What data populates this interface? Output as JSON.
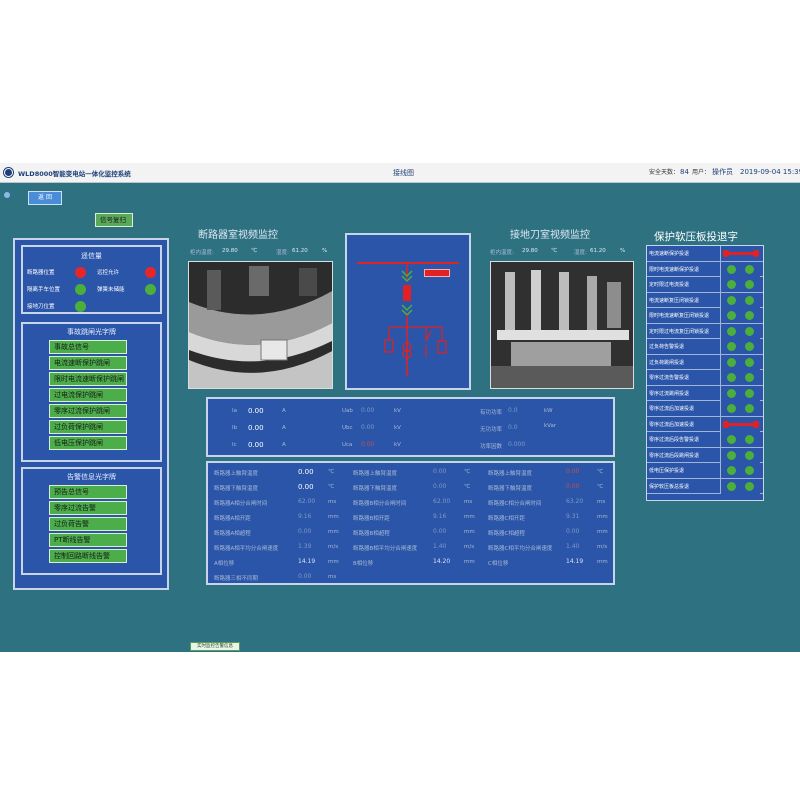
{
  "titlebar": {
    "app_title": "WLD8000智能变电站一体化监控系统",
    "page_name": "接线图",
    "safe_days_label": "安全天数：",
    "safe_days_value": "84",
    "user_label": "用户：",
    "user_value": "操作员",
    "datetime": "2019-09-04 15:39:"
  },
  "top_small_button": "返 回",
  "signal_reset": "信号复归",
  "status_panel": {
    "title": "遥信量",
    "items": [
      {
        "label": "断路器位置",
        "color": "#e8262a"
      },
      {
        "label": "远控允许",
        "color": "#e8262a"
      },
      {
        "label": "隔离手车位置",
        "color": "#4caf3c"
      },
      {
        "label": "弹簧未储能",
        "color": "#4caf3c"
      },
      {
        "label": "接地刀位置",
        "color": "#4caf3c"
      }
    ]
  },
  "trip_panel": {
    "title": "事故跳闸光字牌",
    "buttons": [
      "事故总信号",
      "电流速断保护跳闸",
      "限时电流速断保护跳闸",
      "过电流保护跳闸",
      "零序过流保护跳闸",
      "过负荷保护跳闸",
      "低电压保护跳闸"
    ]
  },
  "alarm_panel": {
    "title": "告警信息光字牌",
    "buttons": [
      "预告总信号",
      "零序过流告警",
      "过负荷告警",
      "PT断线告警",
      "控制回路断线告警"
    ]
  },
  "cam_left": {
    "title": "断路器室视频监控",
    "temp_label": "柜内温度:",
    "temp_value": "29.80",
    "temp_unit": "℃",
    "hum_label": "湿度:",
    "hum_value": "61.20",
    "hum_unit": "%"
  },
  "cam_right": {
    "title": "接地刀室视频监控",
    "temp_label": "柜内温度:",
    "temp_value": "29.80",
    "temp_unit": "℃",
    "hum_label": "湿度:",
    "hum_value": "61.20",
    "hum_unit": "%"
  },
  "diagram": {
    "tag_label": ""
  },
  "measurements": {
    "rows": [
      {
        "a_label": "Ia",
        "a_value": "0.00",
        "a_unit": "A",
        "b_label": "Uab",
        "b_value": "0.00",
        "b_unit": "kV",
        "c_label": "有功功率",
        "c_value": "0.0",
        "c_unit": "kW"
      },
      {
        "a_label": "Ib",
        "a_value": "0.00",
        "a_unit": "A",
        "b_label": "Ubc",
        "b_value": "0.00",
        "b_unit": "kV",
        "c_label": "无功功率",
        "c_value": "0.0",
        "c_unit": "kVar"
      },
      {
        "a_label": "Ic",
        "a_value": "0.00",
        "a_unit": "A",
        "b_label": "Uca",
        "b_value": "0.00",
        "b_unit": "kV",
        "c_label": "功率因数",
        "c_value": "0.000",
        "c_unit": ""
      }
    ]
  },
  "breaker": {
    "col1": [
      {
        "label": "断路器上触臂温度",
        "value": "0.00",
        "unit": "℃"
      },
      {
        "label": "断路器下触臂温度",
        "value": "0.00",
        "unit": "℃"
      },
      {
        "label": "断路器A相分合闸时间",
        "value": "62.00",
        "unit": "ms"
      },
      {
        "label": "断路器A相开距",
        "value": "9.16",
        "unit": "mm"
      },
      {
        "label": "断路器A相超程",
        "value": "0.00",
        "unit": "mm"
      },
      {
        "label": "断路器A相平均分合闸速度",
        "value": "1.39",
        "unit": "m/s"
      },
      {
        "label": "A相位移",
        "value": "14.19",
        "unit": "mm"
      },
      {
        "label": "断路器三相不同期",
        "value": "0.00",
        "unit": "ms"
      }
    ],
    "col2": [
      {
        "label": "断路器上触臂温度",
        "value": "0.00",
        "unit": "℃"
      },
      {
        "label": "断路器下触臂温度",
        "value": "0.00",
        "unit": "℃"
      },
      {
        "label": "断路器B相分合闸时间",
        "value": "62.00",
        "unit": "ms"
      },
      {
        "label": "断路器B相开距",
        "value": "9.16",
        "unit": "mm"
      },
      {
        "label": "断路器B相超程",
        "value": "0.00",
        "unit": "mm"
      },
      {
        "label": "断路器B相平均分合闸速度",
        "value": "1.40",
        "unit": "m/s"
      },
      {
        "label": "B相位移",
        "value": "14.20",
        "unit": "mm"
      }
    ],
    "col3": [
      {
        "label": "断路器上触臂温度",
        "value": "0.00",
        "unit": "℃"
      },
      {
        "label": "断路器下触臂温度",
        "value": "0.00",
        "unit": "℃"
      },
      {
        "label": "断路器C相分合闸时间",
        "value": "63.20",
        "unit": "ms"
      },
      {
        "label": "断路器C相开距",
        "value": "9.31",
        "unit": "mm"
      },
      {
        "label": "断路器C相超程",
        "value": "0.00",
        "unit": "mm"
      },
      {
        "label": "断路器C相平均分合闸速度",
        "value": "1.40",
        "unit": "m/s"
      },
      {
        "label": "C相位移",
        "value": "14.19",
        "unit": "mm"
      }
    ]
  },
  "protection": {
    "title": "保护软压板投退字",
    "rows": [
      {
        "label": "电流速断保护投退",
        "state": "on"
      },
      {
        "label": "限时电流速断保护投退",
        "state": "off"
      },
      {
        "label": "定时限过电流投退",
        "state": "off"
      },
      {
        "label": "电流速断复压闭锁投退",
        "state": "off"
      },
      {
        "label": "限时电流速断复压闭锁投退",
        "state": "off"
      },
      {
        "label": "定时限过电流复压闭锁投退",
        "state": "off"
      },
      {
        "label": "过负荷告警投退",
        "state": "off"
      },
      {
        "label": "过负荷跳闸投退",
        "state": "off"
      },
      {
        "label": "零序过流告警投退",
        "state": "off"
      },
      {
        "label": "零序过流跳闸投退",
        "state": "off"
      },
      {
        "label": "零序过流后加速投退",
        "state": "off"
      },
      {
        "label": "零序过流后加速投退",
        "state": "on"
      },
      {
        "label": "零序过流后段告警投退",
        "state": "off"
      },
      {
        "label": "零序过流后段跳闸投退",
        "state": "off"
      },
      {
        "label": "低电压保护投退",
        "state": "off"
      },
      {
        "label": "保护软压板总投退",
        "state": "off"
      }
    ]
  },
  "taskbar_button": "实时监控告警信息"
}
